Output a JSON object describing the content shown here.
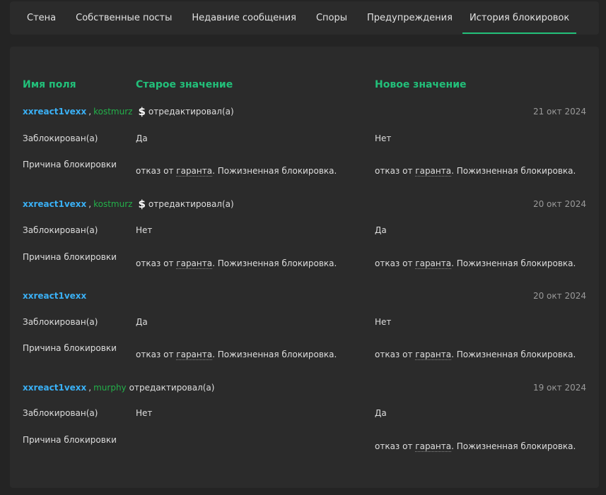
{
  "tabs": [
    {
      "label": "Стена",
      "active": false
    },
    {
      "label": "Собственные посты",
      "active": false
    },
    {
      "label": "Недавние сообщения",
      "active": false
    },
    {
      "label": "Споры",
      "active": false
    },
    {
      "label": "Предупреждения",
      "active": false
    },
    {
      "label": "История блокировок",
      "active": true
    }
  ],
  "table": {
    "headers": {
      "field": "Имя поля",
      "old": "Старое значение",
      "new": "Новое значение"
    },
    "entries": [
      {
        "user": "xxreact1vexx",
        "moderator": "kostmurz",
        "sep": ",",
        "dollar": "$",
        "action": "отредактировал(а)",
        "date": "21 окт 2024",
        "blocked_label": "Заблокирован(а)",
        "blocked_old": "Да",
        "blocked_new": "Нет",
        "reason_label": "Причина блокировки",
        "reason_old_a": "отказ от ",
        "reason_old_b": "гаранта",
        "reason_old_c": ". Пожизненная блокировка.",
        "reason_new_a": "отказ от ",
        "reason_new_b": "гаранта",
        "reason_new_c": ". Пожизненная блокировка."
      },
      {
        "user": "xxreact1vexx",
        "moderator": "kostmurz",
        "sep": ",",
        "dollar": "$",
        "action": "отредактировал(а)",
        "date": "20 окт 2024",
        "blocked_label": "Заблокирован(а)",
        "blocked_old": "Нет",
        "blocked_new": "Да",
        "reason_label": "Причина блокировки",
        "reason_old_a": "отказ от ",
        "reason_old_b": "гаранта",
        "reason_old_c": ". Пожизненная блокировка.",
        "reason_new_a": "отказ от ",
        "reason_new_b": "гаранта",
        "reason_new_c": ". Пожизненная блокировка."
      },
      {
        "user": "xxreact1vexx",
        "date": "20 окт 2024",
        "blocked_label": "Заблокирован(а)",
        "blocked_old": "Да",
        "blocked_new": "Нет",
        "reason_label": "Причина блокировки",
        "reason_old_a": "отказ от ",
        "reason_old_b": "гаранта",
        "reason_old_c": ". Пожизненная блокировка.",
        "reason_new_a": "отказ от ",
        "reason_new_b": "гаранта",
        "reason_new_c": ". Пожизненная блокировка."
      },
      {
        "user": "xxreact1vexx",
        "moderator": "murphy",
        "sep": ",",
        "action": "отредактировал(а)",
        "date": "19 окт 2024",
        "blocked_label": "Заблокирован(а)",
        "blocked_old": "Нет",
        "blocked_new": "Да",
        "reason_label": "Причина блокировки",
        "reason_new_a": "отказ от ",
        "reason_new_b": "гаранта",
        "reason_new_c": ". Пожизненная блокировка."
      }
    ]
  },
  "colors": {
    "accent": "#22c07a",
    "user_link": "#3ab0f5",
    "moderator_link": "#23b04a",
    "panel_bg": "#2b2b2b",
    "page_bg": "#242424"
  }
}
